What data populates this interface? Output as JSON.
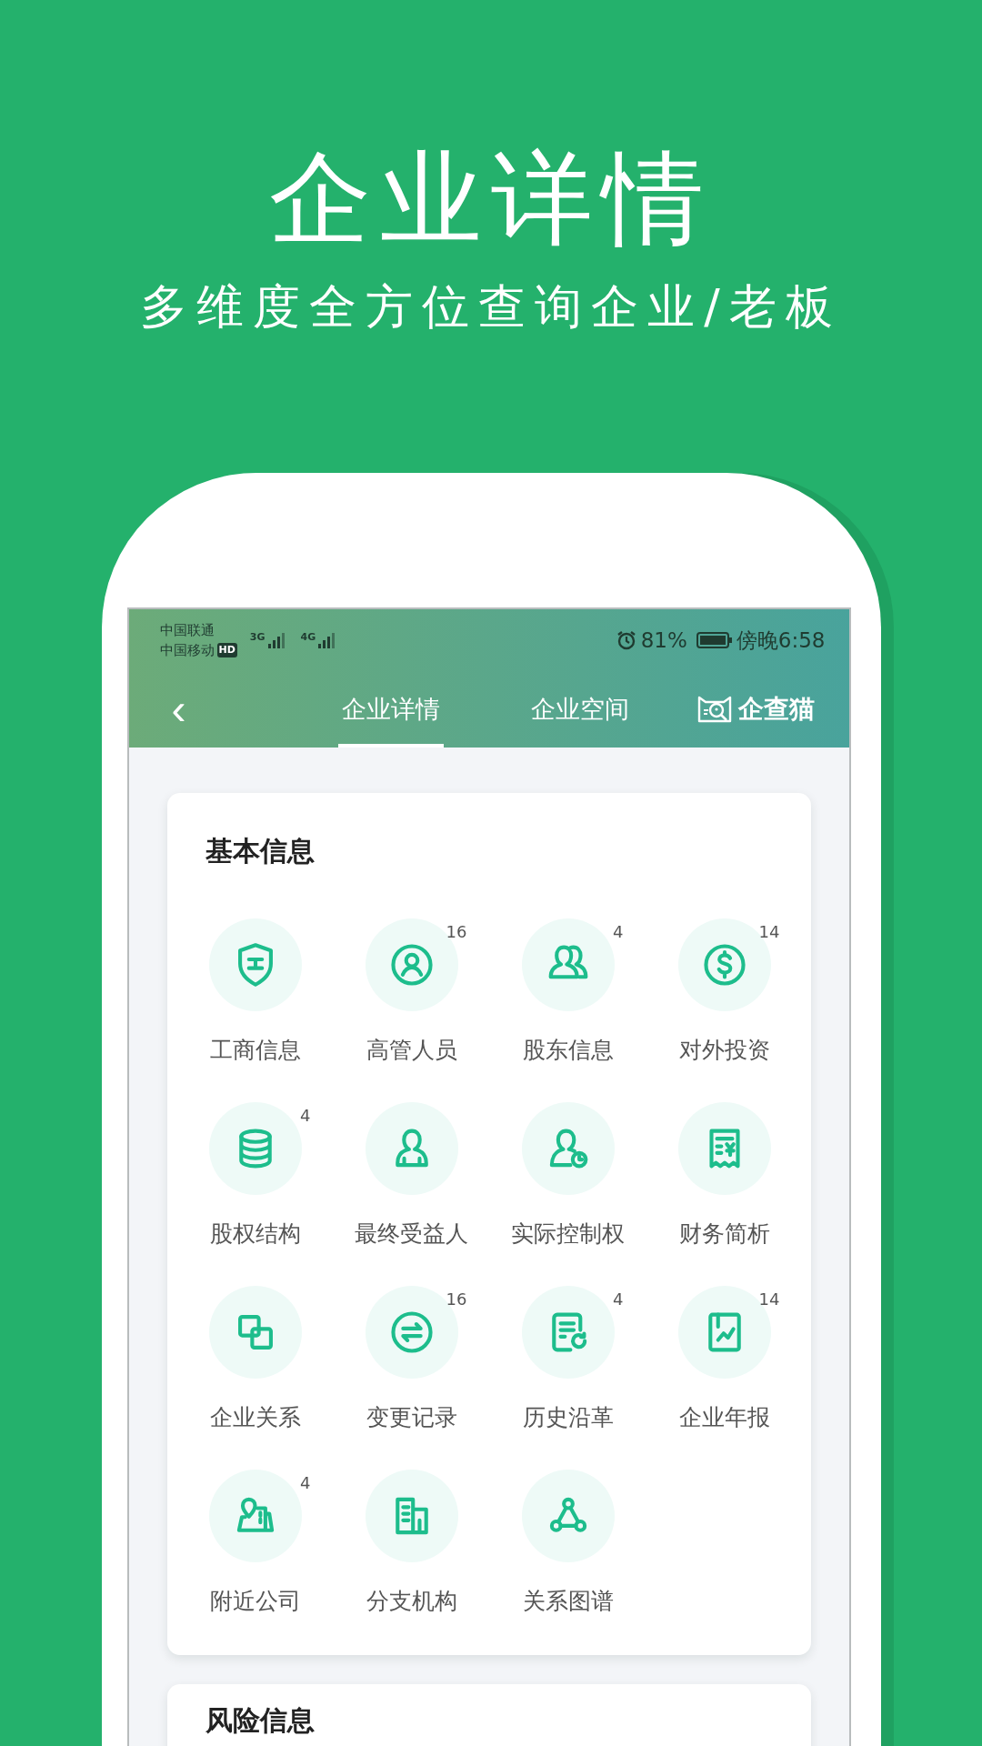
{
  "headline": "企业详情",
  "subheadline": "多维度全方位查询企业/老板",
  "status_bar": {
    "carriers": [
      "中国联通",
      "中国移动"
    ],
    "hd": "HD",
    "networks": [
      "3G",
      "4G"
    ],
    "battery": "81%",
    "time": "傍晚6:58"
  },
  "header": {
    "back": "‹",
    "tabs": [
      {
        "label": "企业详情",
        "selected": true
      },
      {
        "label": "企业空间",
        "selected": false
      }
    ],
    "logo_text": "企查猫"
  },
  "sections": [
    {
      "title": "基本信息",
      "items": [
        {
          "label": "工商信息"
        },
        {
          "label": "高管人员",
          "badge": "16"
        },
        {
          "label": "股东信息",
          "badge": "4"
        },
        {
          "label": "对外投资",
          "badge": "14"
        },
        {
          "label": "股权结构",
          "badge": "4"
        },
        {
          "label": "最终受益人"
        },
        {
          "label": "实际控制权"
        },
        {
          "label": "财务简析"
        },
        {
          "label": "企业关系"
        },
        {
          "label": "变更记录",
          "badge": "16"
        },
        {
          "label": "历史沿革",
          "badge": "4"
        },
        {
          "label": "企业年报",
          "badge": "14"
        },
        {
          "label": "附近公司",
          "badge": "4"
        },
        {
          "label": "分支机构"
        },
        {
          "label": "关系图谱"
        }
      ]
    },
    {
      "title": "风险信息"
    }
  ]
}
